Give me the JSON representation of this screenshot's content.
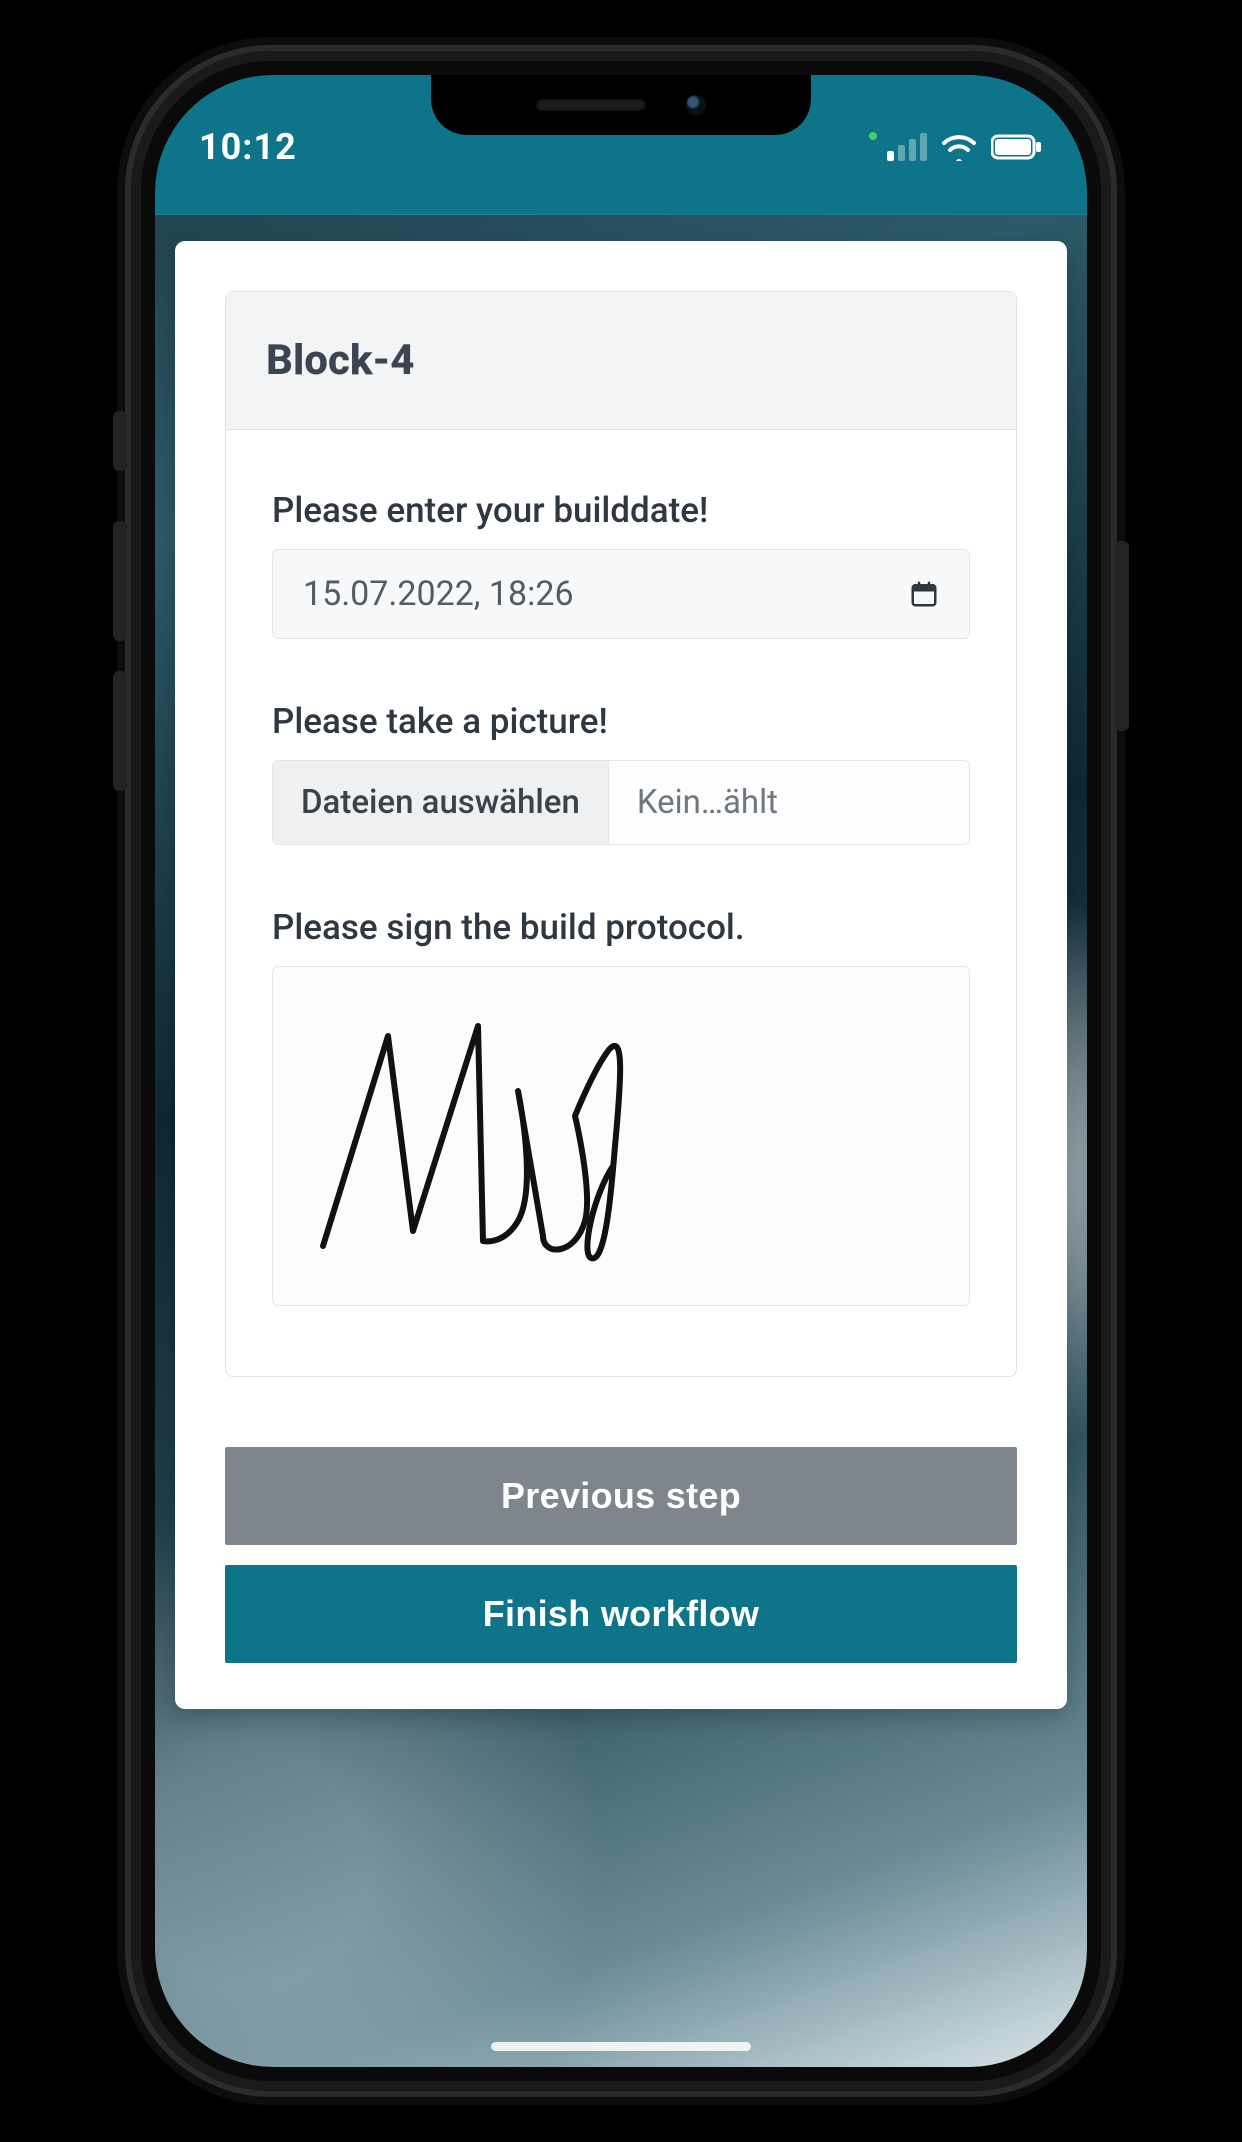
{
  "status": {
    "time": "10:12",
    "signal_filled_bars": 1,
    "gps_active": true
  },
  "block": {
    "title": "Block-4",
    "builddate": {
      "label": "Please enter your builddate!",
      "value": "15.07.2022, 18:26"
    },
    "picture": {
      "label": "Please take a picture!",
      "choose_label": "Dateien auswählen",
      "status_text": "Kein…ählt"
    },
    "signature": {
      "label": "Please sign the build protocol."
    }
  },
  "buttons": {
    "previous": "Previous step",
    "finish": "Finish workflow"
  },
  "colors": {
    "brand_teal": "#0d7489",
    "secondary_gray": "#7e858d"
  }
}
